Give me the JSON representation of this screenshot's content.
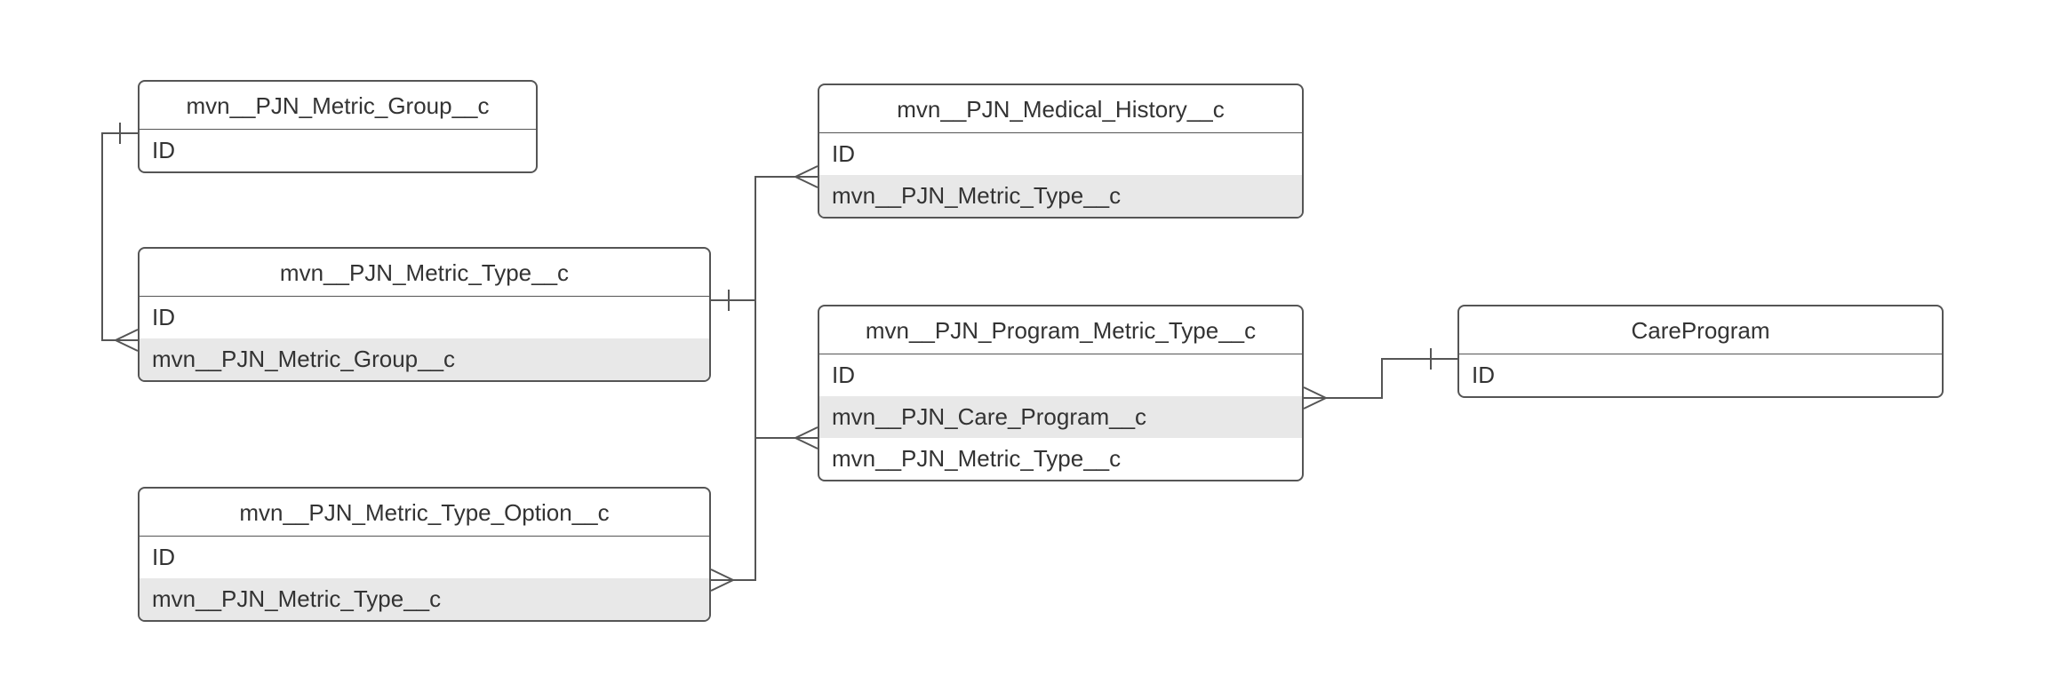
{
  "entities": {
    "metric_group": {
      "title": "mvn__PJN_Metric_Group__c",
      "fields": {
        "id": "ID"
      }
    },
    "metric_type": {
      "title": "mvn__PJN_Metric_Type__c",
      "fields": {
        "id": "ID",
        "group_fk": "mvn__PJN_Metric_Group__c"
      }
    },
    "metric_type_option": {
      "title": "mvn__PJN_Metric_Type_Option__c",
      "fields": {
        "id": "ID",
        "type_fk": "mvn__PJN_Metric_Type__c"
      }
    },
    "medical_history": {
      "title": "mvn__PJN_Medical_History__c",
      "fields": {
        "id": "ID",
        "type_fk": "mvn__PJN_Metric_Type__c"
      }
    },
    "program_metric_type": {
      "title": "mvn__PJN_Program_Metric_Type__c",
      "fields": {
        "id": "ID",
        "care_program_fk": "mvn__PJN_Care_Program__c",
        "type_fk": "mvn__PJN_Metric_Type__c"
      }
    },
    "care_program": {
      "title": "CareProgram",
      "fields": {
        "id": "ID"
      }
    }
  }
}
